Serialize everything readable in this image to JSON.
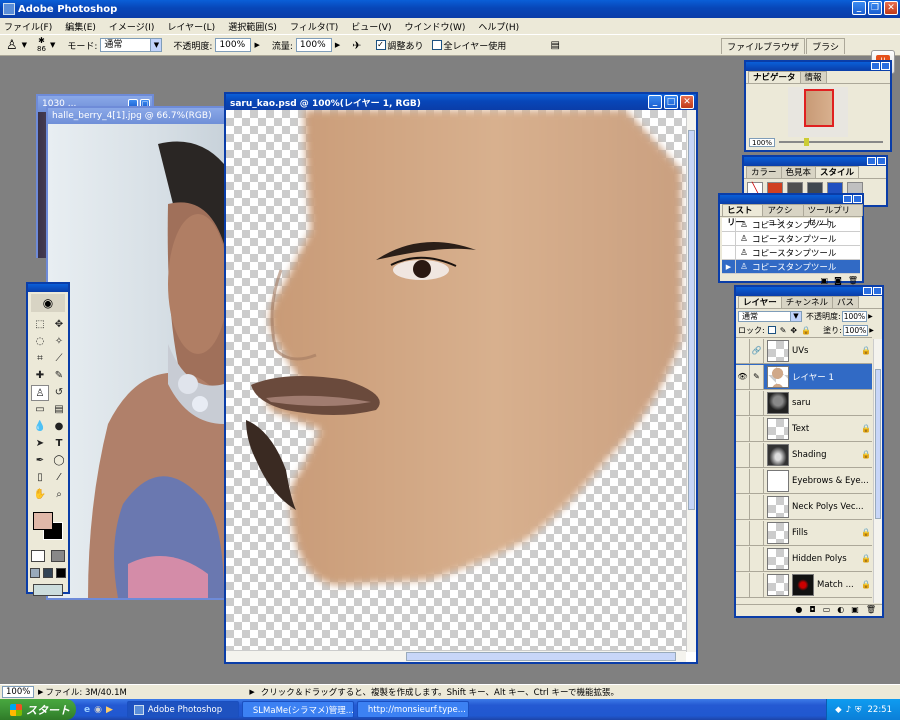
{
  "app": {
    "title": "Adobe Photoshop"
  },
  "menu": [
    "ファイル(F)",
    "編集(E)",
    "イメージ(I)",
    "レイヤー(L)",
    "選択範囲(S)",
    "フィルタ(T)",
    "ビュー(V)",
    "ウインドウ(W)",
    "ヘルプ(H)"
  ],
  "options": {
    "brush_size": "86",
    "mode_label": "モード:",
    "mode_value": "通常",
    "opacity_label": "不透明度:",
    "opacity_value": "100%",
    "flow_label": "流量:",
    "flow_value": "100%",
    "aligned_label": "調整あり",
    "aligned_checked": true,
    "all_layers_label": "全レイヤー使用",
    "all_layers_checked": false
  },
  "palette_well": {
    "tabs": [
      "ファイルブラウザ",
      "ブラシ"
    ]
  },
  "documents": {
    "back": {
      "title": "1030 ..."
    },
    "halle": {
      "title": "halle_berry_4[1].jpg @ 66.7%(RGB)"
    },
    "main": {
      "title": "saru_kao.psd @ 100%(レイヤー 1, RGB)"
    }
  },
  "navigator": {
    "tabs": [
      "ナビゲータ",
      "情報"
    ],
    "zoom": "100%"
  },
  "color": {
    "tabs": [
      "カラー",
      "色見本",
      "スタイル"
    ]
  },
  "history": {
    "tabs": [
      "ヒストリー",
      "アクション",
      "ツールプリセット"
    ],
    "items": [
      "コピースタンプツール",
      "コピースタンプツール",
      "コピースタンプツール",
      "コピースタンプツール"
    ]
  },
  "layers": {
    "tabs": [
      "レイヤー",
      "チャンネル",
      "パス"
    ],
    "blend_mode": "通常",
    "opacity_label": "不透明度:",
    "opacity_value": "100%",
    "lock_label": "ロック:",
    "fill_label": "塗り:",
    "fill_value": "100%",
    "items": [
      {
        "name": "UVs",
        "visible": false,
        "selected": false
      },
      {
        "name": "レイヤー 1",
        "visible": true,
        "selected": true
      },
      {
        "name": "saru",
        "visible": false,
        "selected": false
      },
      {
        "name": "Text",
        "visible": false,
        "selected": false
      },
      {
        "name": "Shading",
        "visible": false,
        "selected": false
      },
      {
        "name": "Eyebrows & Eye...",
        "visible": false,
        "selected": false
      },
      {
        "name": "Neck Polys Vec...",
        "visible": false,
        "selected": false
      },
      {
        "name": "Fills",
        "visible": false,
        "selected": false
      },
      {
        "name": "Hidden Polys",
        "visible": false,
        "selected": false
      },
      {
        "name": "Match ...",
        "visible": false,
        "selected": false
      }
    ]
  },
  "status": {
    "zoom": "100%",
    "file_info": "ファイル: 3M/40.1M",
    "hint": "クリック＆ドラッグすると、複製を作成します。Shift キー、Alt キー、Ctrl キーで機能拡張。"
  },
  "taskbar": {
    "start": "スタート",
    "items": [
      "Adobe Photoshop",
      "SLMaMe(シラマメ)管理...",
      "http://monsieurf.type..."
    ],
    "clock": "22:51"
  }
}
